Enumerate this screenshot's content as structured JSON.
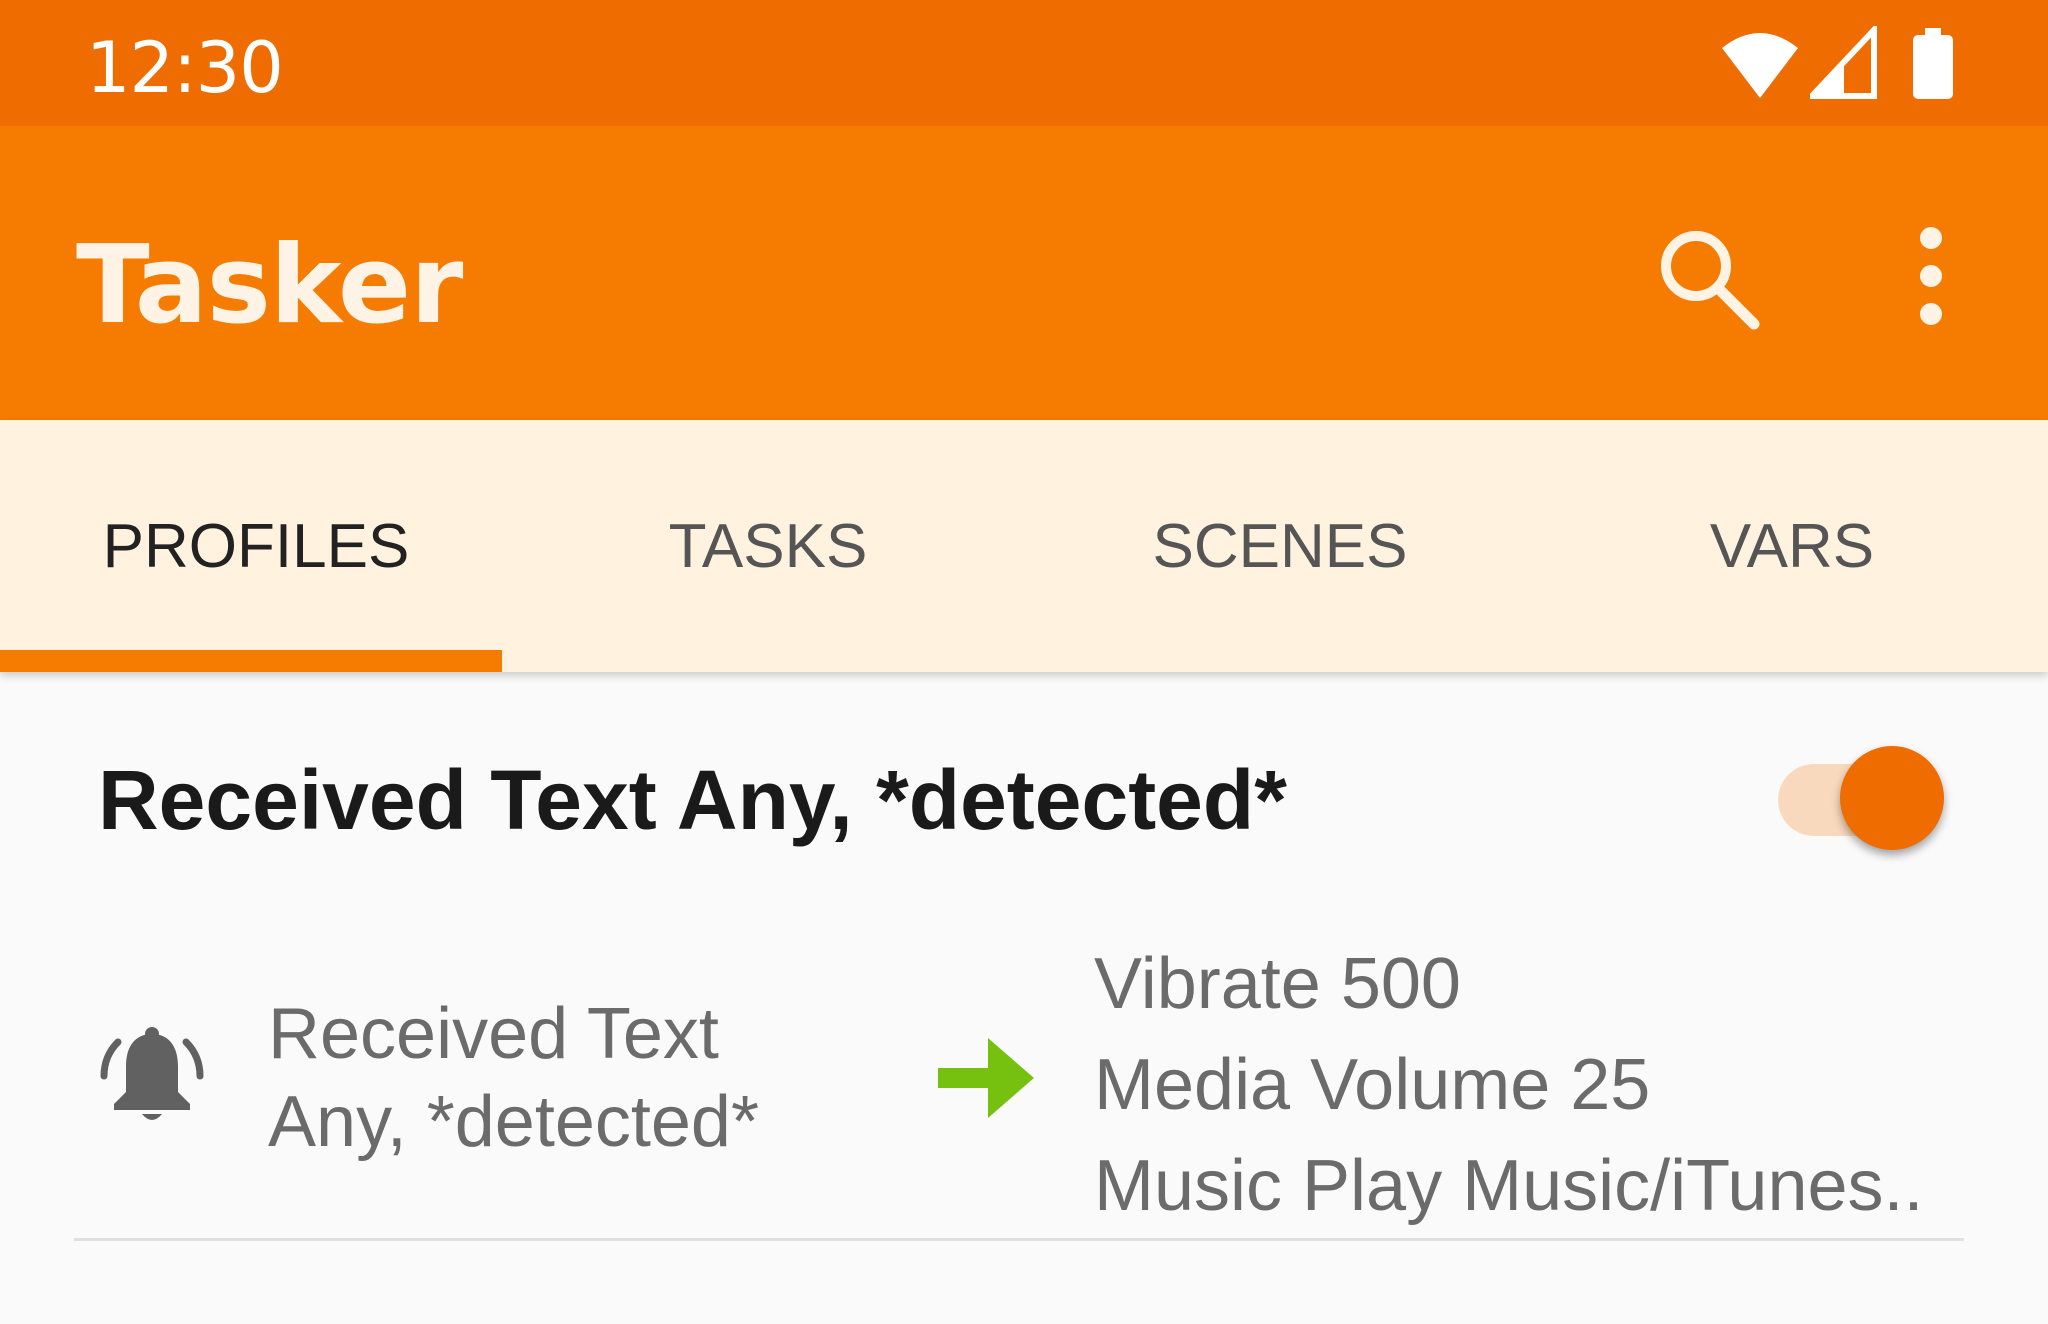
{
  "status_bar": {
    "time": "12:30",
    "icons": [
      "wifi-icon",
      "cell-signal-icon",
      "battery-icon"
    ]
  },
  "app_bar": {
    "title": "Tasker",
    "actions": [
      "search-icon",
      "more-vert-icon"
    ]
  },
  "tabs": [
    {
      "label": "PROFILES",
      "active": true
    },
    {
      "label": "TASKS",
      "active": false
    },
    {
      "label": "SCENES",
      "active": false
    },
    {
      "label": "VARS",
      "active": false
    }
  ],
  "profile": {
    "name": "Received Text Any, *detected*",
    "enabled": true,
    "context": {
      "icon": "bell-ringing-icon",
      "lines": [
        "Received Text",
        "Any, *detected*"
      ]
    },
    "arrow_icon": "arrow-right-icon",
    "tasks": [
      "Vibrate 500",
      "Media Volume 25",
      "Music Play Music/iTunes.."
    ]
  },
  "colors": {
    "status_bar": "#ef6c00",
    "app_bar": "#f57c00",
    "tab_bar": "#fff3e0",
    "accent": "#f57c00",
    "arrow": "#76c10f"
  }
}
